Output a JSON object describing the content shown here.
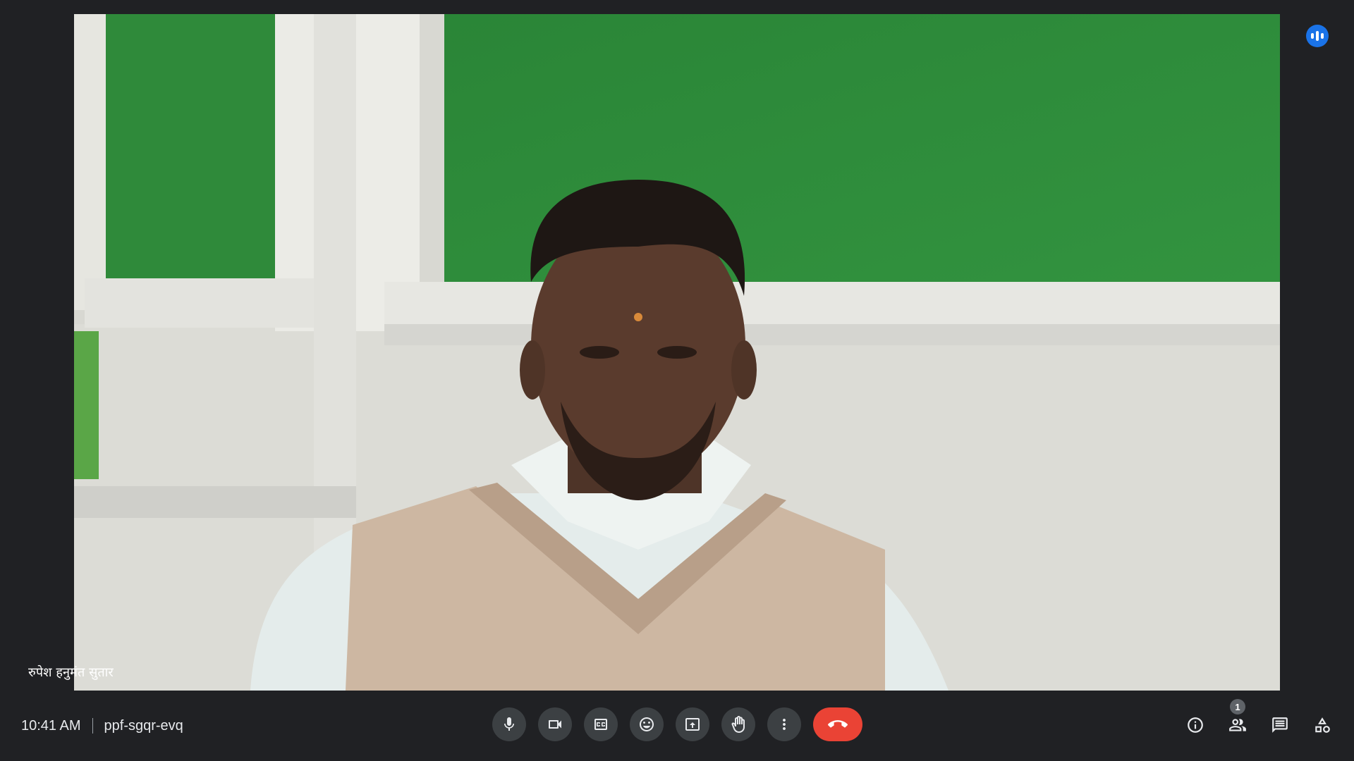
{
  "meeting": {
    "time": "10:41 AM",
    "code": "ppf-sgqr-evq"
  },
  "participant": {
    "name": "रुपेश हनुमंत सुतार",
    "is_speaking": true
  },
  "controls": [
    {
      "name": "microphone",
      "icon": "mic-icon"
    },
    {
      "name": "camera",
      "icon": "videocam-icon"
    },
    {
      "name": "captions",
      "icon": "closed-captions-icon"
    },
    {
      "name": "reactions",
      "icon": "emoji-icon"
    },
    {
      "name": "present",
      "icon": "present-screen-icon"
    },
    {
      "name": "raise-hand",
      "icon": "hand-icon"
    },
    {
      "name": "more-options",
      "icon": "more-vert-icon"
    },
    {
      "name": "leave-call",
      "icon": "call-end-icon"
    }
  ],
  "side_controls": {
    "info_icon": "info-icon",
    "people_icon": "people-icon",
    "people_count": "1",
    "chat_icon": "chat-icon",
    "activities_icon": "activities-icon"
  },
  "colors": {
    "background": "#202124",
    "control_button": "#3c4043",
    "end_call": "#ea4335",
    "speaking_indicator": "#1a73e8"
  }
}
